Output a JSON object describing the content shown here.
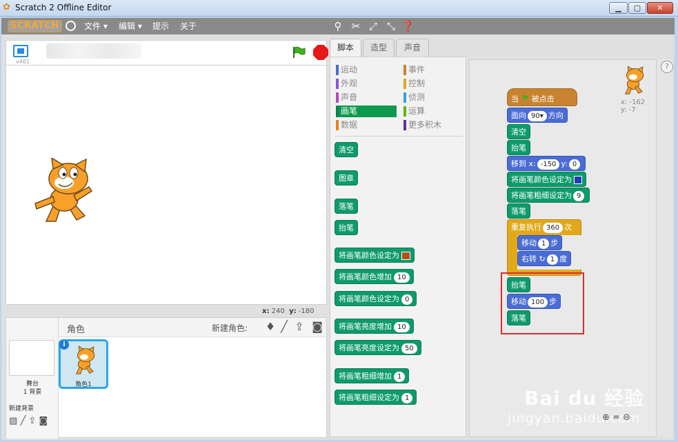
{
  "window": {
    "title": "Scratch 2 Offline Editor",
    "min": "▁",
    "max": "▢",
    "close": "✕"
  },
  "menubar": {
    "logo": "SCRATCH",
    "file": "文件 ▾",
    "edit": "编辑 ▾",
    "tips": "提示",
    "about": "关于"
  },
  "stage": {
    "version": "v461",
    "coords_x_label": "x:",
    "coords_x": "240",
    "coords_y_label": "y:",
    "coords_y": "-180"
  },
  "sprites": {
    "header": "角色",
    "new_sprite": "新建角色:",
    "stage_label": "舞台",
    "stage_backdrops": "1 背景",
    "new_backdrop": "新建背景",
    "sprite_name": "角色1",
    "info": "i"
  },
  "tabs": [
    "脚本",
    "造型",
    "声音"
  ],
  "categories": [
    {
      "label": "运动",
      "color": "#4a6cd4"
    },
    {
      "label": "事件",
      "color": "#c88330"
    },
    {
      "label": "外观",
      "color": "#8a55d7"
    },
    {
      "label": "控制",
      "color": "#e1a91a"
    },
    {
      "label": "声音",
      "color": "#bb42c3"
    },
    {
      "label": "侦测",
      "color": "#2ca5e2"
    },
    {
      "label": "画笔",
      "color": "#0e9a6c"
    },
    {
      "label": "运算",
      "color": "#5cb712"
    },
    {
      "label": "数据",
      "color": "#ee7d16"
    },
    {
      "label": "更多积木",
      "color": "#632d99"
    }
  ],
  "palette_blocks": {
    "clear": "清空",
    "stamp": "图章",
    "pen_down": "落笔",
    "pen_up": "抬笔",
    "set_color_to": "将画笔颜色设定为",
    "change_color_by": "将画笔颜色增加",
    "change_color_by_val": "10",
    "set_color_num": "将画笔颜色设定为",
    "set_color_num_val": "0",
    "change_shade_by": "将画笔亮度增加",
    "change_shade_by_val": "10",
    "set_shade_to": "将画笔亮度设定为",
    "set_shade_to_val": "50",
    "change_size_by": "将画笔粗细增加",
    "change_size_by_val": "1",
    "set_size_to": "将画笔粗细设定为",
    "set_size_to_val": "1"
  },
  "script": {
    "when": "当",
    "clicked": "被点击",
    "point_dir": "面向",
    "point_dir_val": "90▾",
    "point_dir_suffix": "方向",
    "clear": "清空",
    "pen_up": "抬笔",
    "goto": "移到 x:",
    "goto_x": "-150",
    "goto_y_label": "y:",
    "goto_y": "0",
    "set_color": "将画笔颜色设定为",
    "set_size": "将画笔粗细设定为",
    "set_size_val": "9",
    "pen_down": "落笔",
    "repeat": "重复执行",
    "repeat_val": "360",
    "repeat_suffix": "次",
    "move": "移动",
    "move_val": "1",
    "move_suffix": "步",
    "turn": "右转 ↻",
    "turn_val": "1",
    "turn_suffix": "度",
    "pen_up2": "抬笔",
    "move2": "移动",
    "move2_val": "100",
    "move2_suffix": "步",
    "pen_down2": "落笔"
  },
  "readout": {
    "x": "x: -162",
    "y": "y: -7"
  },
  "watermark": {
    "line1": "Bai du 经验",
    "line2": "jingyan.baidu.com"
  },
  "help": "?"
}
